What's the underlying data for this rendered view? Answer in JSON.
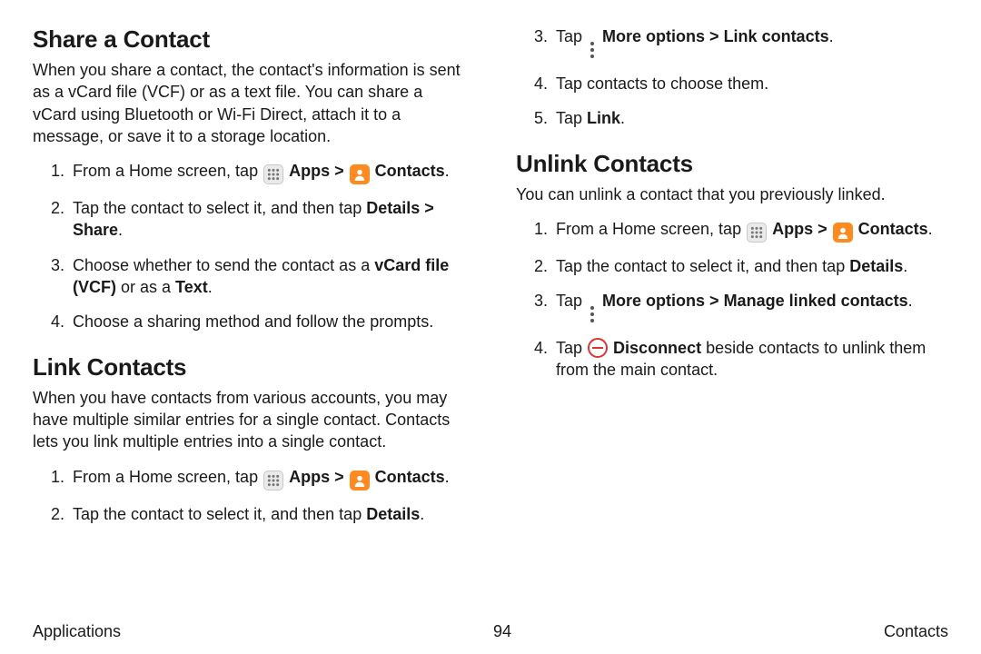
{
  "footer": {
    "left": "Applications",
    "page": "94",
    "right": "Contacts"
  },
  "left": {
    "share": {
      "heading": "Share a Contact",
      "intro": "When you share a contact, the contact's information is sent as a vCard file (VCF) or as a text file. You can share a vCard using Bluetooth or Wi-Fi Direct, attach it to a message, or save it to a storage location.",
      "s1a": "From a Home screen, tap ",
      "apps": "Apps",
      "gt": " > ",
      "contacts": "Contacts",
      "dot": ".",
      "s2a": "Tap the contact to select it, and then tap ",
      "details": "Details",
      "s2b": " > ",
      "share_lbl": "Share",
      "s3a": "Choose whether to send the contact as a ",
      "vcf": "vCard file (VCF)",
      "s3b": " or as a ",
      "text": "Text",
      "s4": "Choose a sharing method and follow the prompts."
    },
    "link": {
      "heading": "Link Contacts",
      "intro": "When you have contacts from various accounts, you may have multiple similar entries for a single contact. Contacts lets you link multiple entries into a single contact.",
      "s1a": "From a Home screen, tap ",
      "apps": "Apps",
      "gt": " > ",
      "contacts": "Contacts",
      "dot": ".",
      "s2a": "Tap the contact to select it, and then tap ",
      "details": "Details"
    }
  },
  "right": {
    "s3a": "Tap ",
    "more": "More options",
    "gt": " > ",
    "linkc": "Link contacts",
    "dot": ".",
    "s4": "Tap contacts to choose them.",
    "s5a": "Tap ",
    "link_lbl": "Link",
    "unlink": {
      "heading": "Unlink Contacts",
      "intro": "You can unlink a contact that you previously linked.",
      "s1a": "From a Home screen, tap ",
      "apps": "Apps",
      "gt": " > ",
      "contacts": "Contacts",
      "dot": ".",
      "s2a": "Tap the contact to select it, and then tap ",
      "details": "Details",
      "s3a": "Tap ",
      "more": "More options",
      "manage": "Manage linked contacts",
      "s4a": "Tap ",
      "disc": "Disconnect",
      "s4b": " beside contacts to unlink them from the main contact."
    }
  }
}
